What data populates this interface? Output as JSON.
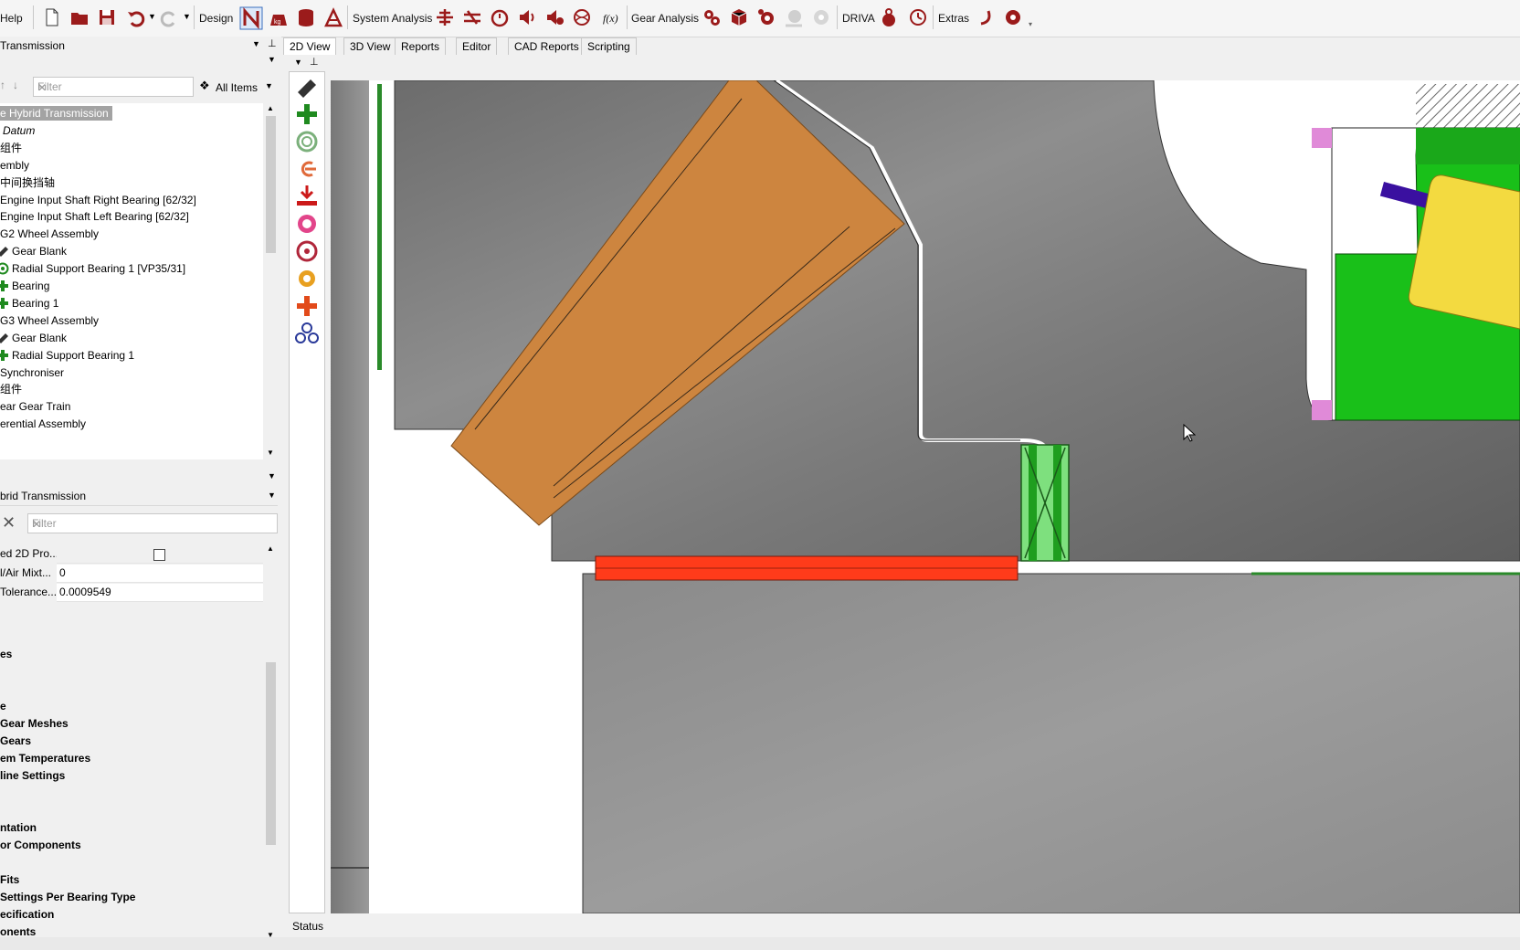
{
  "toolbar": {
    "help": "Help",
    "design": "Design",
    "system_analysis": "System Analysis",
    "gear_analysis": "Gear Analysis",
    "driva": "DRIVA",
    "extras": "Extras",
    "fx": "f(x)"
  },
  "left": {
    "model_combo": "Transmission",
    "filter_placeholder": "Filter",
    "all_items": "All Items",
    "tree": [
      {
        "label": "e Hybrid Transmission",
        "selected": true,
        "icon": ""
      },
      {
        "label": "Datum",
        "italic": true,
        "icon": ""
      },
      {
        "label": "组件",
        "icon": ""
      },
      {
        "label": "embly",
        "icon": ""
      },
      {
        "label": "中间换挡轴",
        "icon": ""
      },
      {
        "label": "Engine Input Shaft Right Bearing [62/32]",
        "icon": ""
      },
      {
        "label": "Engine Input Shaft Left Bearing [62/32]",
        "icon": ""
      },
      {
        "label": "G2 Wheel Assembly",
        "icon": ""
      },
      {
        "label": "Gear Blank",
        "icon": "gear-blank-icon"
      },
      {
        "label": "Radial Support Bearing 1 [VP35/31]",
        "icon": "radial-bearing-icon"
      },
      {
        "label": "Bearing",
        "icon": "bearing-icon"
      },
      {
        "label": "Bearing 1",
        "icon": "bearing-icon"
      },
      {
        "label": "G3 Wheel Assembly",
        "icon": ""
      },
      {
        "label": "Gear Blank",
        "icon": "gear-blank-icon"
      },
      {
        "label": "Radial Support Bearing 1",
        "icon": "bearing-icon"
      },
      {
        "label": "Synchroniser",
        "icon": ""
      },
      {
        "label": "组件",
        "icon": ""
      },
      {
        "label": "ear Gear Train",
        "icon": ""
      },
      {
        "label": "erential Assembly",
        "icon": ""
      }
    ],
    "props_combo": "brid Transmission",
    "props_filter_placeholder": "Filter",
    "props": [
      {
        "name": "ed 2D Pro...",
        "value": "",
        "checkbox": true
      },
      {
        "name": "l/Air Mixt...",
        "value": "0"
      },
      {
        "name": "Tolerance...",
        "value": "0.0009549"
      }
    ],
    "categories": [
      "es",
      "e",
      "Gear Meshes",
      "Gears",
      "em Temperatures",
      "line Settings",
      "ntation",
      "or Components",
      "Fits",
      "Settings Per Bearing Type",
      "ecification",
      "onents"
    ]
  },
  "tabs": [
    "2D View",
    "3D View",
    "Reports",
    "Editor",
    "CAD Reports",
    "Scripting"
  ],
  "active_tab": "2D View",
  "status": "Status",
  "colors": {
    "accent_red": "#9b1b1b",
    "bronze": "#cd853f",
    "bearing_green": "#1f9e1f",
    "red_bar": "#ff3b1a",
    "housing_gray": "#8a8a8a"
  }
}
